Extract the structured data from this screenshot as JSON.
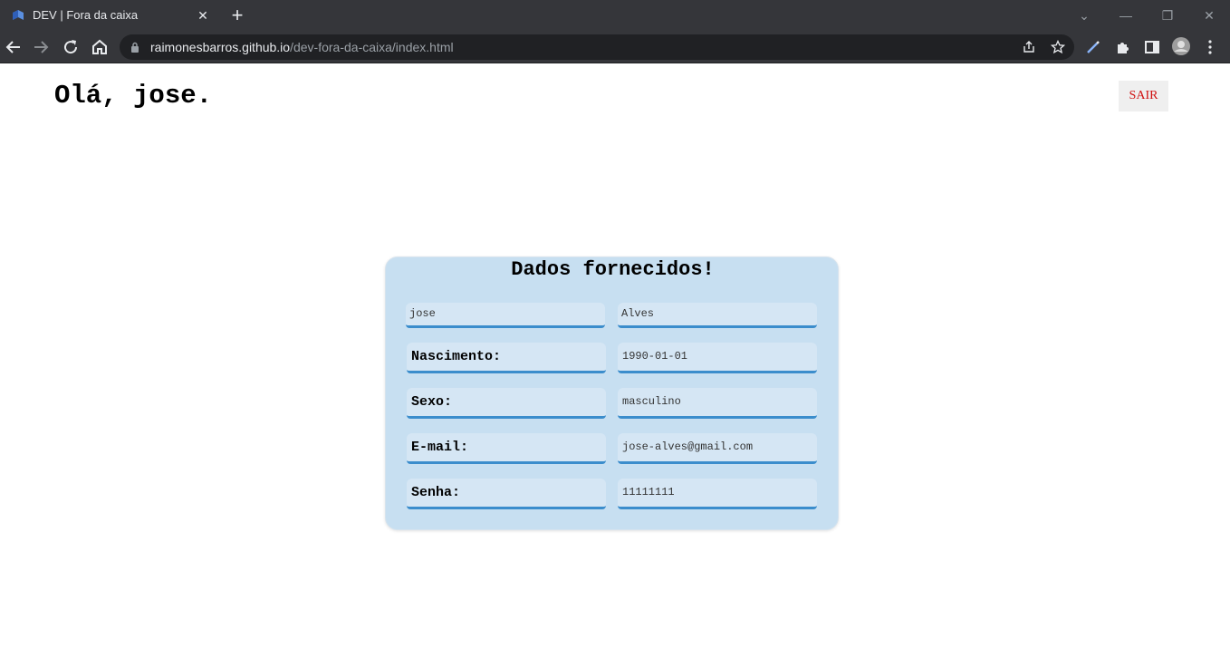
{
  "browser": {
    "tab": {
      "title": "DEV | Fora da caixa",
      "close_glyph": "✕"
    },
    "new_tab_glyph": "+",
    "window_controls": {
      "dropdown_glyph": "⌄",
      "minimize_glyph": "—",
      "restore_glyph": "❐",
      "close_glyph": "✕"
    },
    "address": {
      "host": "raimonesbarros.github.io",
      "path": "/dev-fora-da-caixa/index.html"
    },
    "icons": [
      "back-icon",
      "forward-icon",
      "reload-icon",
      "home-icon",
      "lock-icon",
      "share-icon",
      "star-icon",
      "pen-icon",
      "extensions-icon",
      "sidebar-icon",
      "profile-avatar",
      "menu-icon"
    ]
  },
  "page": {
    "greeting": "Olá, jose.",
    "logout_label": "SAIR",
    "card": {
      "title": "Dados fornecidos!",
      "first_name": "jose",
      "last_name": "Alves",
      "birth_label": "Nascimento:",
      "birth_value": "1990-01-01",
      "sex_label": "Sexo:",
      "sex_value": "masculino",
      "email_label": "E-mail:",
      "email_value": "jose-alves@gmail.com",
      "password_label": "Senha:",
      "password_value": "11111111"
    }
  },
  "colors": {
    "chrome_bg": "#35363a",
    "omnibox_bg": "#202124",
    "card_bg": "#c7dff1",
    "field_bg": "#d5e6f4",
    "field_border": "#3b8dcc",
    "logout_text": "#d01010"
  }
}
